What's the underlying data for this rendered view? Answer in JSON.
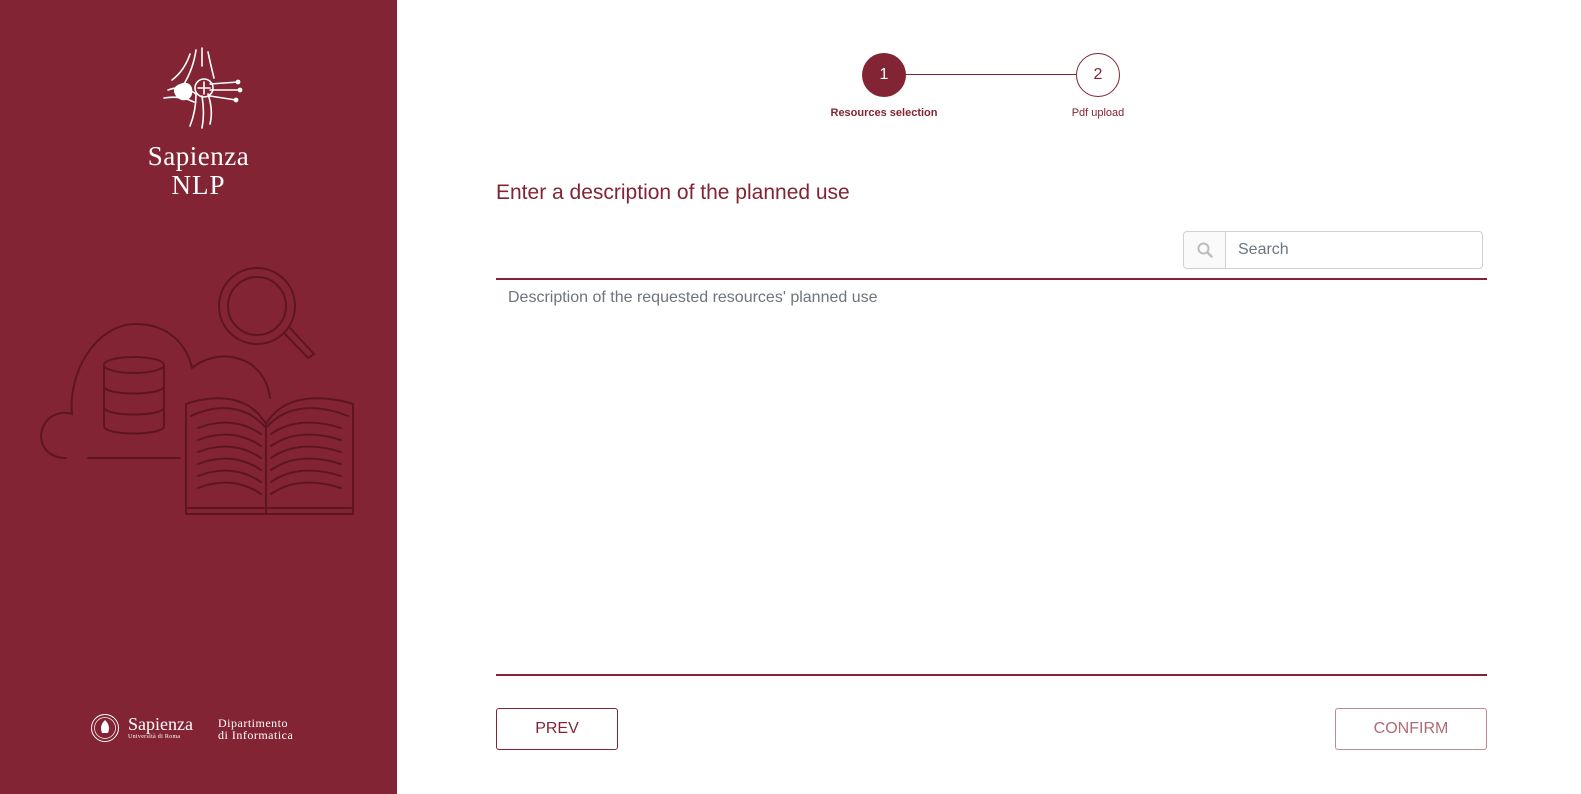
{
  "sidebar": {
    "brand_line1": "Sapienza",
    "brand_line2": "NLP",
    "footer": {
      "sapienza": "Sapienza",
      "university": "Università di Roma",
      "dept_line1": "Dipartimento",
      "dept_line2": "di Informatica"
    }
  },
  "stepper": {
    "steps": [
      {
        "number": "1",
        "label": "Resources selection",
        "state": "active"
      },
      {
        "number": "2",
        "label": "Pdf upload",
        "state": "inactive"
      }
    ]
  },
  "main": {
    "title": "Enter a description of the planned use",
    "search": {
      "placeholder": "Search",
      "value": ""
    },
    "description": {
      "placeholder": "Description of the requested resources' planned use",
      "value": ""
    }
  },
  "actions": {
    "prev_label": "PREV",
    "confirm_label": "CONFIRM"
  },
  "colors": {
    "brand": "#822433",
    "white": "#ffffff",
    "placeholder": "#6c757d"
  }
}
